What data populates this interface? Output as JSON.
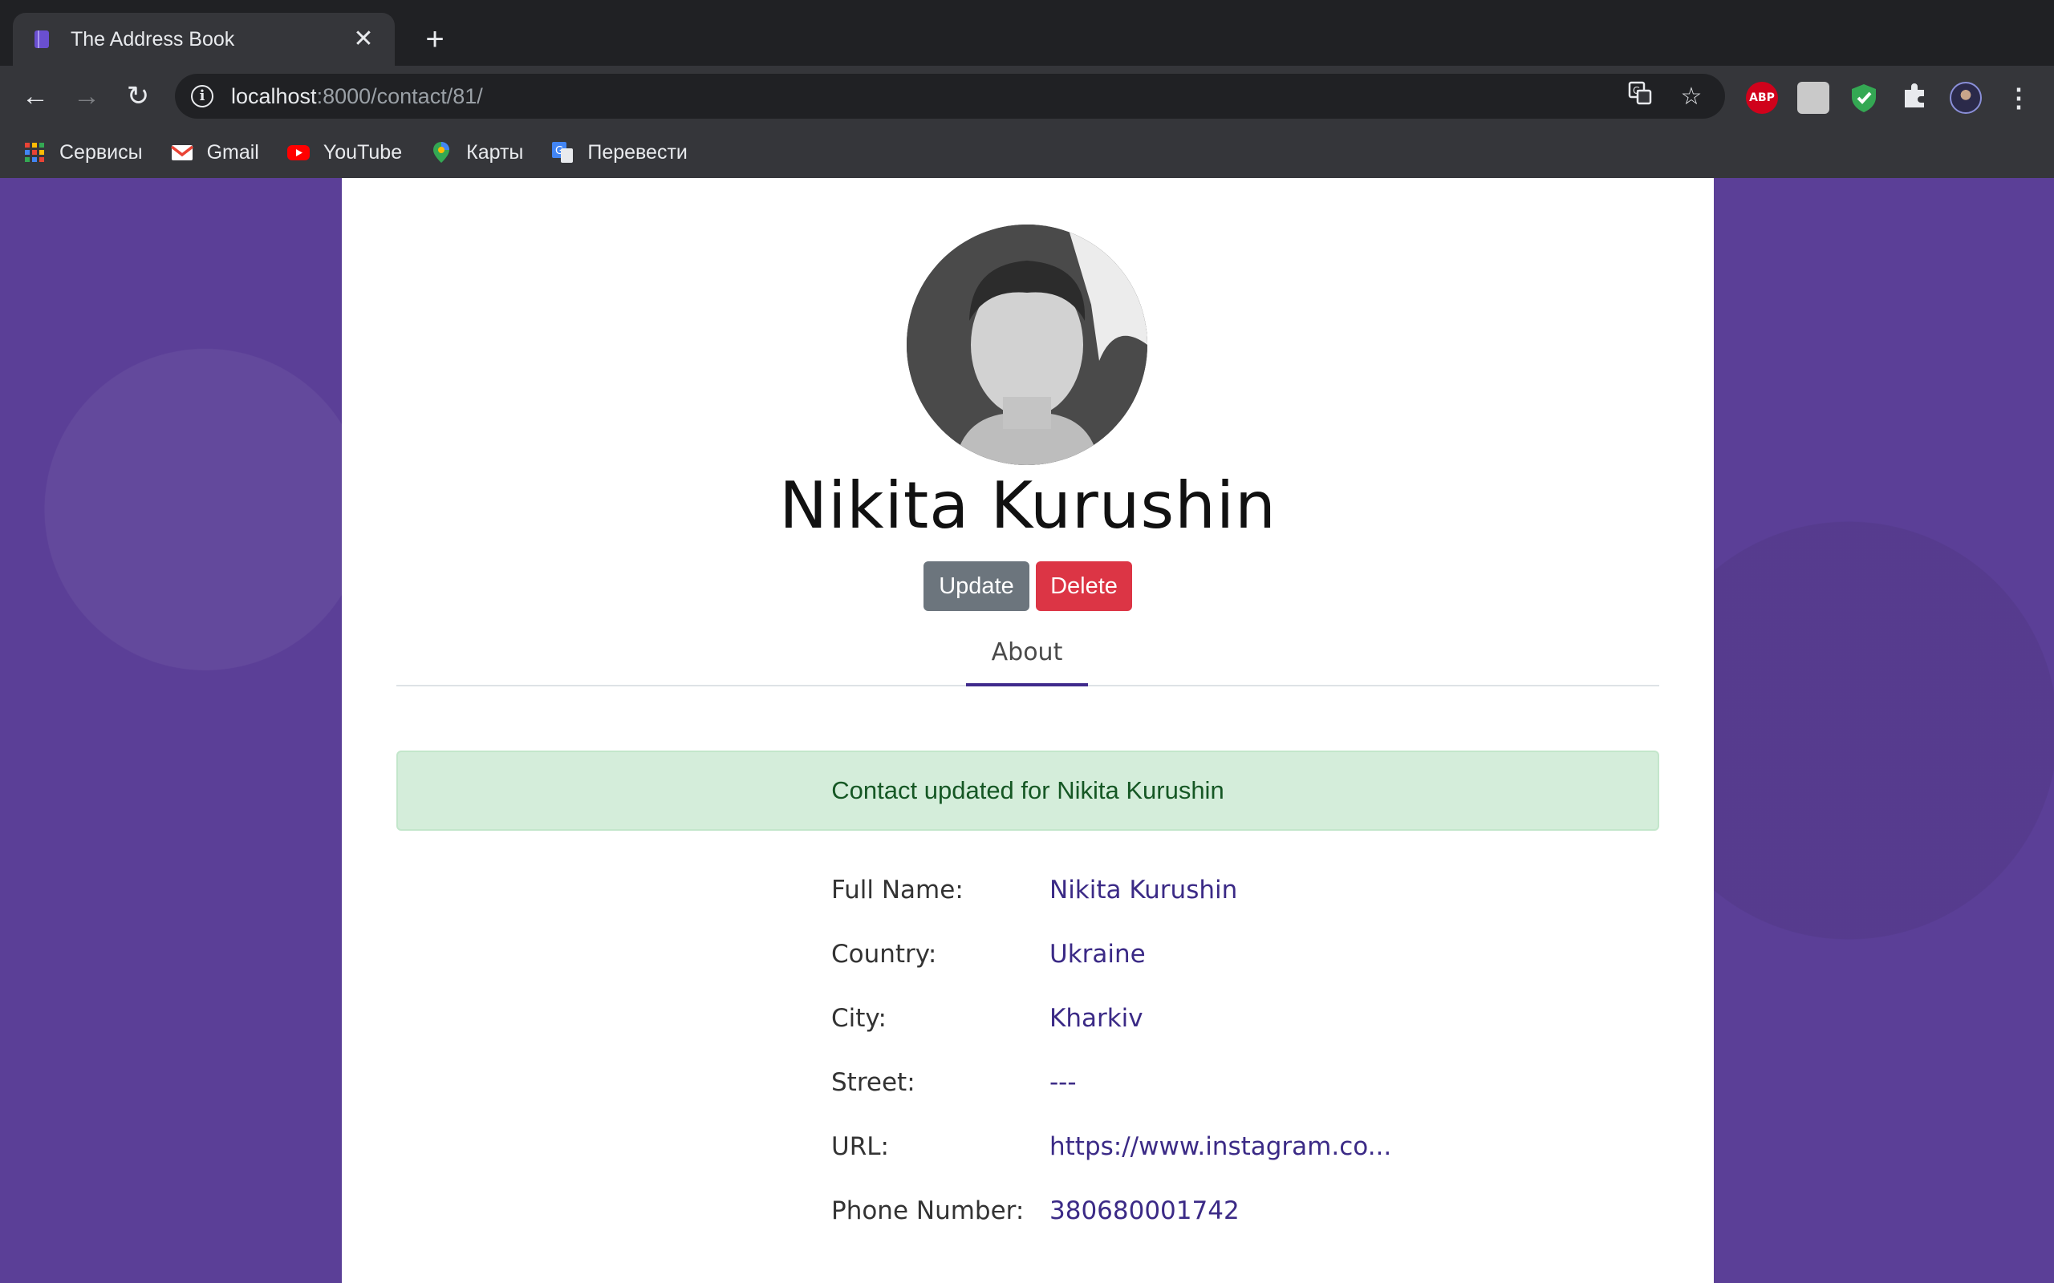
{
  "browser": {
    "tab_title": "The Address Book",
    "tab_close": "✕",
    "new_tab": "+",
    "url_host": "localhost",
    "url_rest": ":8000/contact/81/",
    "bookmarks": [
      {
        "label": "Сервисы",
        "icon": "apps-grid-icon"
      },
      {
        "label": "Gmail",
        "icon": "gmail-icon"
      },
      {
        "label": "YouTube",
        "icon": "youtube-icon"
      },
      {
        "label": "Карты",
        "icon": "maps-pin-icon"
      },
      {
        "label": "Перевести",
        "icon": "translate-icon"
      }
    ],
    "extensions": [
      {
        "name": "adblock-plus-icon",
        "text": "ABP"
      },
      {
        "name": "extension-grey-icon"
      },
      {
        "name": "shield-check-icon"
      },
      {
        "name": "extensions-puzzle-icon"
      },
      {
        "name": "profile-avatar-icon"
      },
      {
        "name": "menu-kebab-icon"
      }
    ]
  },
  "contact": {
    "name": "Nikita Kurushin",
    "update_label": "Update",
    "delete_label": "Delete",
    "tab_label": "About",
    "alert_text": "Contact updated for Nikita Kurushin",
    "fields": [
      {
        "label": "Full Name:",
        "value": "Nikita Kurushin"
      },
      {
        "label": "Country:",
        "value": "Ukraine"
      },
      {
        "label": "City:",
        "value": "Kharkiv"
      },
      {
        "label": "Street:",
        "value": "---"
      },
      {
        "label": "URL:",
        "value": "https://www.instagram.co..."
      },
      {
        "label": "Phone Number:",
        "value": "380680001742"
      }
    ]
  },
  "colors": {
    "accent": "#3f2a8c",
    "background": "#5b3f97",
    "update": "#6c757d",
    "delete": "#dc3545",
    "alert_bg": "#d4edda",
    "alert_text": "#155724"
  }
}
